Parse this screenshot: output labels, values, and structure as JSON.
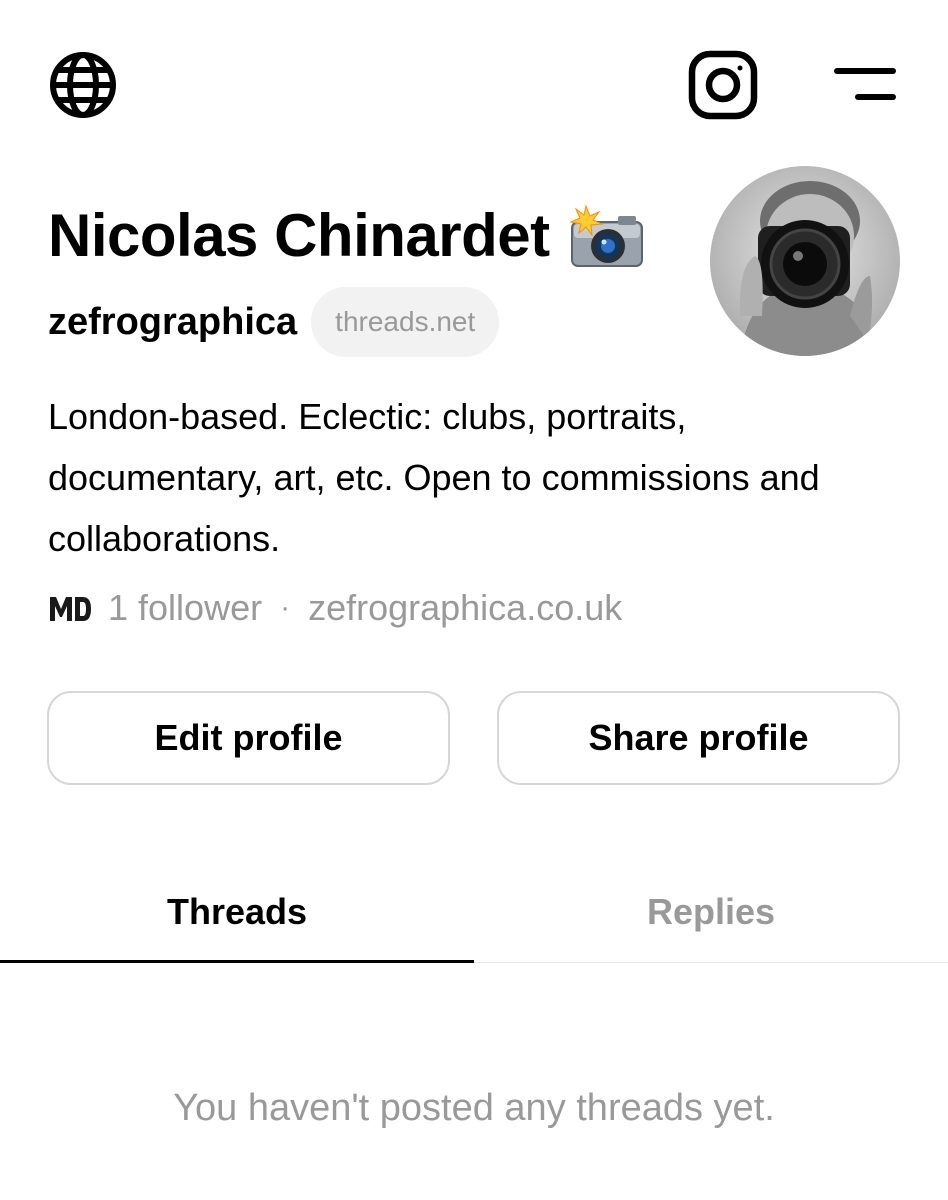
{
  "profile": {
    "name": "Nicolas Chinardet",
    "name_emoji": "camera-with-flash",
    "handle": "zefrographica",
    "domain_chip": "threads.net",
    "bio": "London-based. Eclectic: clubs, portraits, documentary, art, etc. Open to commissions and collaborations.",
    "followers": "1 follower",
    "separator": "·",
    "website": "zefrographica.co.uk"
  },
  "header": {
    "icons": [
      "globe-icon",
      "instagram-icon",
      "menu-icon"
    ]
  },
  "actions": {
    "edit_label": "Edit profile",
    "share_label": "Share profile"
  },
  "tabs": [
    {
      "label": "Threads",
      "active": true
    },
    {
      "label": "Replies",
      "active": false
    }
  ],
  "empty_state": "You haven't posted any threads yet.",
  "colors": {
    "text": "#000000",
    "muted": "#999999",
    "chip_bg": "#f2f2f2",
    "border": "#d6d6d6"
  }
}
